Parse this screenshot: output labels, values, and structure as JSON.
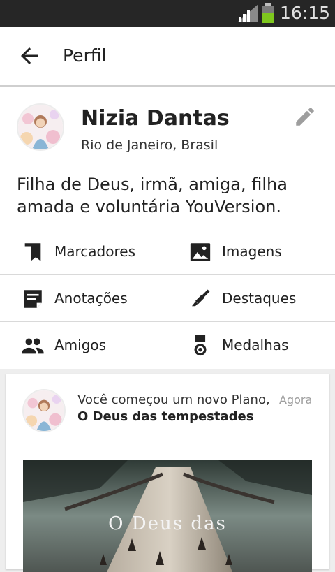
{
  "status_bar": {
    "time": "16:15",
    "signal_icon": "signal-icon",
    "battery_icon": "battery-icon"
  },
  "app_bar": {
    "title": "Perfil",
    "back_icon": "arrow-back-icon"
  },
  "profile": {
    "name": "Nizia Dantas",
    "location": "Rio de Janeiro, Brasil",
    "bio": "Filha de Deus, irmã, amiga, filha amada e voluntária YouVersion.",
    "edit_icon": "pencil-icon"
  },
  "menu": [
    {
      "label": "Marcadores",
      "icon": "bookmark-icon"
    },
    {
      "label": "Imagens",
      "icon": "image-icon"
    },
    {
      "label": "Anotações",
      "icon": "note-icon"
    },
    {
      "label": "Destaques",
      "icon": "highlighter-icon"
    },
    {
      "label": "Amigos",
      "icon": "people-icon"
    },
    {
      "label": "Medalhas",
      "icon": "medal-icon"
    }
  ],
  "feed": {
    "activity_prefix": "Você começou um novo Plano, ",
    "plan_name": "O Deus das tempestades",
    "time": "Agora",
    "image_caption": "O Deus das"
  },
  "colors": {
    "status_bar": "#262626",
    "app_bar": "#ffffff",
    "divider": "#d9d9d9",
    "text": "#222222",
    "muted": "#9e9e9e"
  }
}
